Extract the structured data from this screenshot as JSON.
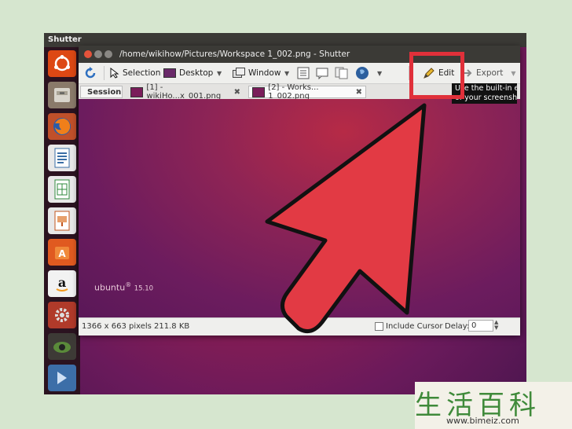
{
  "desktop": {
    "topbar_title": "Shutter",
    "wallpaper_brand": "ubuntu",
    "wallpaper_version": "15.10"
  },
  "window": {
    "title": "/home/wikihow/Pictures/Workspace 1_002.png - Shutter"
  },
  "toolbar": {
    "selection_label": "Selection",
    "desktop_label": "Desktop",
    "window_label": "Window",
    "edit_label": "Edit",
    "export_label": "Export"
  },
  "tabs": {
    "session_label": "Session",
    "tab1_label": "[1] - wikiHo...x_001.png",
    "tab2_label": "[2] - Works... 1_002.png"
  },
  "statusbar": {
    "image_info": "1366 x 663 pixels  211.8 KB",
    "include_cursor_label": "Include Cursor",
    "delay_label": "Delay:",
    "delay_value": "0"
  },
  "tooltip": {
    "line1": "Use the built-in edito",
    "line2": "of your screenshot c"
  },
  "watermark": {
    "chinese": "生活百科",
    "url": "www.bimeiz.com"
  },
  "colors": {
    "highlight": "#e0303a",
    "arrow_fill": "#e23a44",
    "ubuntu_orange": "#dd4814"
  }
}
